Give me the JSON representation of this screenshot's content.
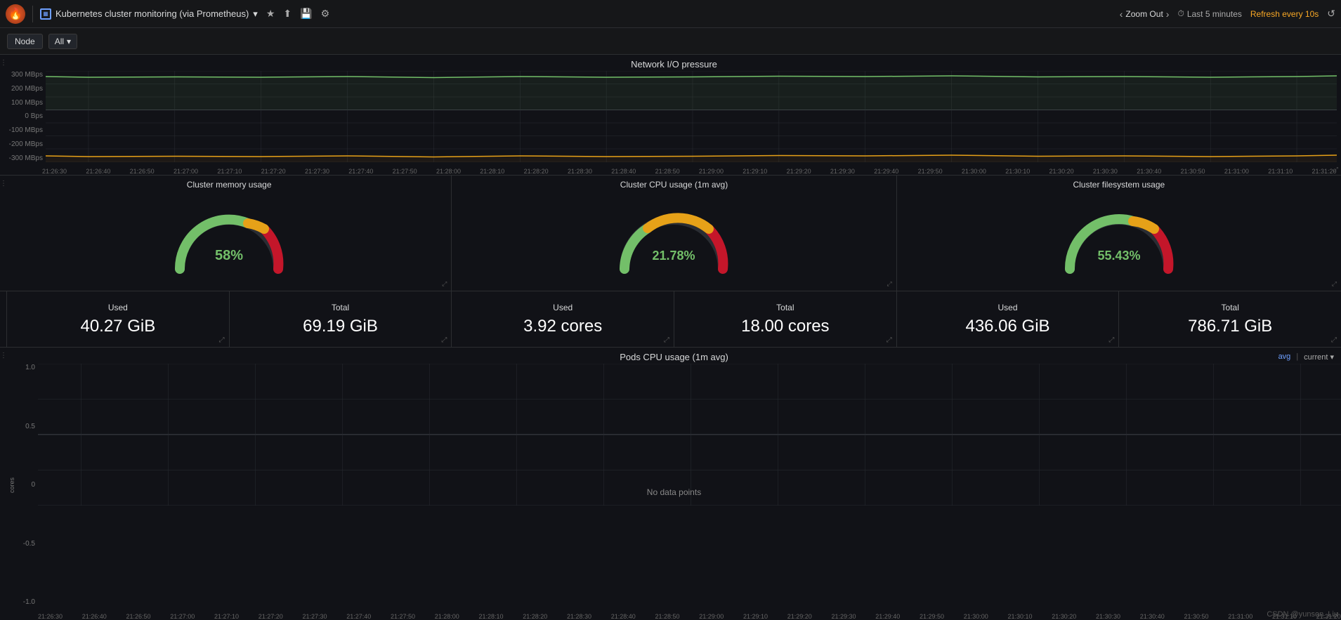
{
  "app": {
    "logo": "🔥",
    "title": "Kubernetes cluster monitoring (via Prometheus)",
    "title_icon": "⊞",
    "dropdown_arrow": "▾"
  },
  "nav": {
    "star_label": "★",
    "share_label": "⬆",
    "save_label": "💾",
    "settings_label": "⚙",
    "zoom_out": "Zoom Out",
    "zoom_chevron_left": "‹",
    "zoom_chevron_right": "›",
    "time_icon": "⏱",
    "time_range": "Last 5 minutes",
    "refresh": "Refresh every 10s",
    "refresh_icon": "↺"
  },
  "filters": {
    "node_label": "Node",
    "all_label": "All",
    "all_arrow": "▾"
  },
  "network_panel": {
    "title": "Network I/O pressure",
    "y_labels": [
      "300 MBps",
      "200 MBps",
      "100 MBps",
      "0 Bps",
      "-100 MBps",
      "-200 MBps",
      "-300 MBps"
    ],
    "x_labels": [
      "21:26:30",
      "21:26:40",
      "21:26:50",
      "21:27:00",
      "21:27:10",
      "21:27:20",
      "21:27:30",
      "21:27:40",
      "21:27:50",
      "21:28:00",
      "21:28:10",
      "21:28:20",
      "21:28:30",
      "21:28:40",
      "21:28:50",
      "21:29:00",
      "21:29:10",
      "21:29:20",
      "21:29:30",
      "21:29:40",
      "21:29:50",
      "21:30:00",
      "21:30:10",
      "21:30:20",
      "21:30:30",
      "21:30:40",
      "21:30:50",
      "21:31:00",
      "21:31:10",
      "21:31:20"
    ]
  },
  "gauges": [
    {
      "title": "Cluster memory usage",
      "value": "58%",
      "percent": 58,
      "color": "#73bf69"
    },
    {
      "title": "Cluster CPU usage (1m avg)",
      "value": "21.78%",
      "percent": 21.78,
      "color": "#73bf69"
    },
    {
      "title": "Cluster filesystem usage",
      "value": "55.43%",
      "percent": 55.43,
      "color": "#73bf69"
    }
  ],
  "stats": [
    {
      "label": "Used",
      "value": "40.27 GiB"
    },
    {
      "label": "Total",
      "value": "69.19 GiB"
    },
    {
      "label": "Used",
      "value": "3.92 cores"
    },
    {
      "label": "Total",
      "value": "18.00 cores"
    },
    {
      "label": "Used",
      "value": "436.06 GiB"
    },
    {
      "label": "Total",
      "value": "786.71 GiB"
    }
  ],
  "pods_panel": {
    "title": "Pods CPU usage (1m avg)",
    "legend_avg": "avg",
    "legend_separator": " | ",
    "legend_current": "current ▾",
    "no_data": "No data points",
    "y_axis_label": "cores",
    "y_labels": [
      "1.0",
      "0.5",
      "0",
      "-0.5",
      "-1.0"
    ],
    "x_labels": [
      "21:26:30",
      "21:26:40",
      "21:26:50",
      "21:27:00",
      "21:27:10",
      "21:27:20",
      "21:27:30",
      "21:27:40",
      "21:27:50",
      "21:28:00",
      "21:28:10",
      "21:28:20",
      "21:28:30",
      "21:28:40",
      "21:28:50",
      "21:29:00",
      "21:29:10",
      "21:29:20",
      "21:29:30",
      "21:29:40",
      "21:29:50",
      "21:30:00",
      "21:30:10",
      "21:30:20",
      "21:30:30",
      "21:30:40",
      "21:30:50",
      "21:31:00",
      "21:31:10",
      "21:31:20"
    ]
  },
  "watermark": "CSDN @yunson_Liu"
}
